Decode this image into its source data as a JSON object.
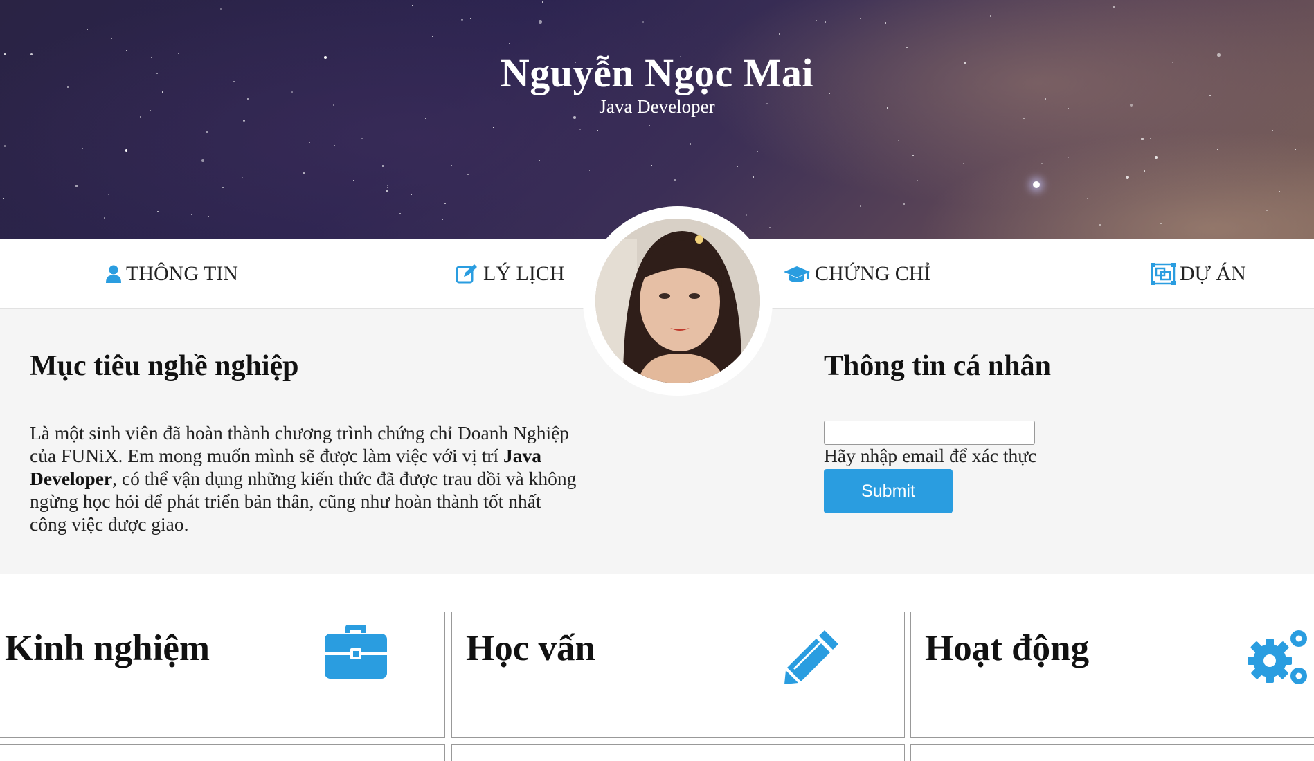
{
  "header": {
    "name": "Nguyễn Ngọc Mai",
    "role": "Java Developer"
  },
  "nav": {
    "items": [
      {
        "label": "THÔNG TIN",
        "icon": "user-icon"
      },
      {
        "label": "LÝ LỊCH",
        "icon": "edit-icon"
      },
      {
        "label": "CHỨNG CHỈ",
        "icon": "graduation-cap-icon"
      },
      {
        "label": "DỰ ÁN",
        "icon": "object-group-icon"
      }
    ]
  },
  "about": {
    "goal_title": "Mục tiêu nghề nghiệp",
    "goal_text_1": "Là một sinh viên đã hoàn thành chương trình chứng chỉ Doanh Nghiệp của FUNiX. Em mong muốn mình sẽ được làm việc với vị trí ",
    "goal_text_bold": "Java Developer",
    "goal_text_2": ", có thể vận dụng những kiến thức đã được trau dồi và không ngừng học hỏi để phát triển bản thân, cũng như hoàn thành tốt nhất công việc được giao.",
    "info_title": "Thông tin cá nhân",
    "email_value": "",
    "email_hint": "Hãy nhập email để xác thực",
    "submit_label": "Submit"
  },
  "cards": [
    {
      "title": "Kinh nghiệm",
      "icon": "briefcase-icon"
    },
    {
      "title": "Học vấn",
      "icon": "pencil-icon"
    },
    {
      "title": "Hoạt động",
      "icon": "gears-icon"
    }
  ],
  "colors": {
    "accent": "#2a9de0",
    "section_bg": "#f5f5f5"
  }
}
